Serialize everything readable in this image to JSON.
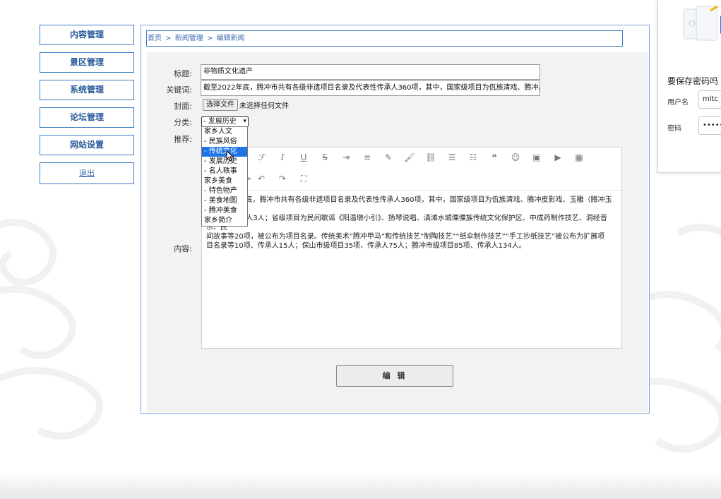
{
  "menu": {
    "content": "内容管理",
    "scenic": "景区管理",
    "system": "系统管理",
    "forum": "论坛管理",
    "website": "网站设置",
    "logout": "退出"
  },
  "breadcrumb": {
    "home": "首页",
    "sep": ">",
    "news": "新闻管理",
    "edit": "编辑新闻"
  },
  "form": {
    "title_label": "标题:",
    "title_value": "非物质文化遗产",
    "keywords_label": "关键词:",
    "keywords_value": "截至2022年底，腾冲市共有各级非遗项目名录及代表性传承人360项，其中，国家级项目为佤族清戏、腾冲皮",
    "cover_label": "封面:",
    "file_button": "选择文件",
    "file_status": "未选择任何文件",
    "category_label": "分类:",
    "category_selected": "- 发展历史",
    "recommend_label": "推荐:",
    "content_label": "内容:",
    "submit": "编 辑"
  },
  "category_options": [
    {
      "label": "家乡人文"
    },
    {
      "label": "- 民族风俗"
    },
    {
      "label": "- 传统文化"
    },
    {
      "label": "- 发展历史"
    },
    {
      "label": "- 名人轶事"
    },
    {
      "label": "家乡美食"
    },
    {
      "label": "- 特色物产"
    },
    {
      "label": "- 美食地图"
    },
    {
      "label": "- 腾冲美食"
    },
    {
      "label": "家乡简介"
    }
  ],
  "dropdown_highlight": "- 传统文化",
  "editor": {
    "toolbar_icons": [
      "heading-icon",
      "font-size-icon",
      "font-family-icon",
      "italic-icon",
      "underline-icon",
      "strikethrough-icon",
      "indent-icon",
      "line-height-icon",
      "highlight-icon",
      "brush-icon",
      "link-icon",
      "bullet-list-icon",
      "ordered-list-icon",
      "quote-icon",
      "emoji-icon",
      "image-icon",
      "video-icon",
      "table-icon",
      "code-icon",
      "undo-icon",
      "redo-icon",
      "fullscreen-icon"
    ],
    "content_lines": [
      "截至2022年底，腾冲市共有各级非遗项目名录及代表性传承人360项，其中，国家级项目为佤族清戏、腾冲皮影戏、玉雕（腾冲玉雕）",
      "等3项、传承人3人；省级项目为民间歌谣《阳温墩小引》、扬琴说唱、滇滩水城傈僳族传统文化保护区、中成药制作技艺、洞经音乐、民",
      "间故事等20项，被公布为项目名录。传统美术“腾冲甲马”和传统技艺“制陶技艺”“纸伞制作技艺”“手工抄纸技艺”被公布为扩展项",
      "目名录等10项、传承人15人；保山市级项目35项、传承人75人；腾冲市级项目85项、传承人134人。"
    ]
  },
  "password_popup": {
    "title": "要保存密码吗",
    "username_label": "用户名",
    "username_value": "mltc",
    "password_label": "密码",
    "password_mask": "••••••"
  },
  "colors": {
    "menu_border": "#3a7cc3",
    "menu_text": "#2a5a9a",
    "select_highlight": "#1e74e6"
  }
}
